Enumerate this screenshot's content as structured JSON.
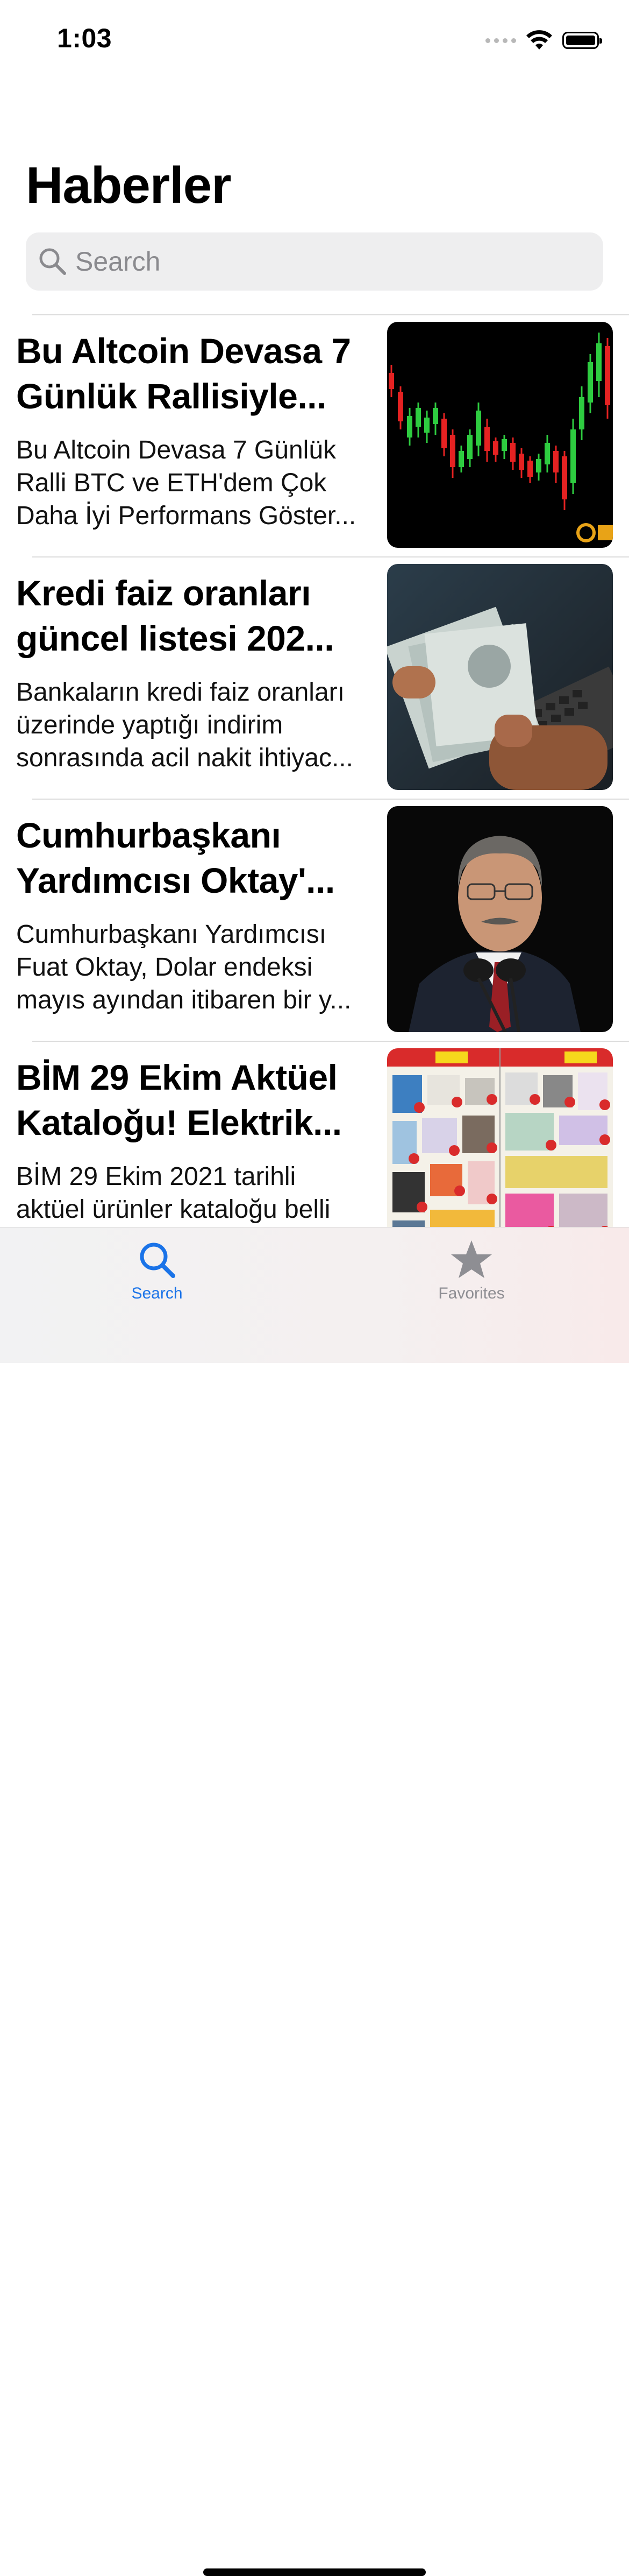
{
  "status_bar": {
    "time": "1:03"
  },
  "page_title": "Haberler",
  "search": {
    "placeholder": "Search",
    "icon": "search-icon"
  },
  "articles": [
    {
      "title": "Bu Altcoin Devasa 7 Günlük Rallisiyle...",
      "description": "Bu Altcoin Devasa 7 Günlük Ralli BTC ve ETH'dem Çok Daha İyi Performans Göster...",
      "image": "candlestick-chart-image"
    },
    {
      "title": "Kredi faiz oranları güncel listesi 202...",
      "description": "Bankaların kredi faiz oranları üzerinde yaptığı indirim sonrasında acil nakit ihtiyac...",
      "image": "banknotes-image"
    },
    {
      "title": "Cumhurbaşkanı Yardımcısı Oktay'...",
      "description": "Cumhurbaşkanı Yardımcısı Fuat Oktay, Dolar endeksi mayıs ayından itibaren bir y...",
      "image": "speaker-portrait-image"
    },
    {
      "title": "BİM 29 Ekim Aktüel Kataloğu! Elektrik...",
      "description": "BİM 29 Ekim 2021 tarihli aktüel ürünler kataloğu belli",
      "image": "catalog-image"
    }
  ],
  "tab_bar": {
    "tabs": [
      {
        "label": "Search",
        "icon": "search-icon",
        "selected": true,
        "color": "#1a73e8"
      },
      {
        "label": "Favorites",
        "icon": "star-icon",
        "selected": false,
        "color": "#8e8e93"
      }
    ]
  }
}
